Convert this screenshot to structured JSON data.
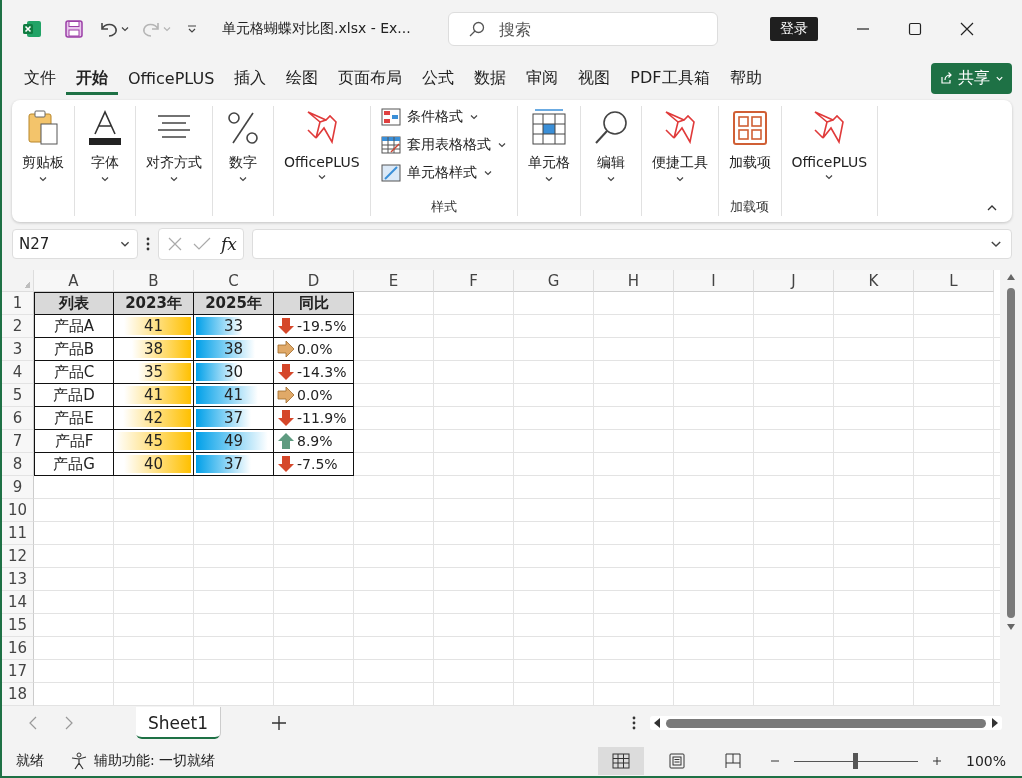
{
  "title_bar": {
    "file_title": "单元格蝴蝶对比图.xlsx  -  Ex...",
    "search": {
      "placeholder": "搜索"
    },
    "sign_in": "登录",
    "redo_disabled": true
  },
  "menu_tabs": [
    {
      "label": "文件",
      "selected": false
    },
    {
      "label": "开始",
      "selected": true
    },
    {
      "label": "OfficePLUS",
      "selected": false
    },
    {
      "label": "插入",
      "selected": false
    },
    {
      "label": "绘图",
      "selected": false
    },
    {
      "label": "页面布局",
      "selected": false
    },
    {
      "label": "公式",
      "selected": false
    },
    {
      "label": "数据",
      "selected": false
    },
    {
      "label": "审阅",
      "selected": false
    },
    {
      "label": "视图",
      "selected": false
    },
    {
      "label": "PDF工具箱",
      "selected": false
    },
    {
      "label": "帮助",
      "selected": false
    }
  ],
  "share_button": "共享",
  "ribbon": [
    {
      "buttons": [
        {
          "kind": "clipboard",
          "label": "剪贴板",
          "dropdown": true
        }
      ]
    },
    {
      "buttons": [
        {
          "kind": "font",
          "label": "字体",
          "dropdown": true
        }
      ]
    },
    {
      "buttons": [
        {
          "kind": "align",
          "label": "对齐方式",
          "dropdown": true
        }
      ]
    },
    {
      "buttons": [
        {
          "kind": "percent",
          "label": "数字",
          "dropdown": true
        }
      ]
    },
    {
      "buttons": [
        {
          "kind": "bird",
          "label": "OfficePLUS",
          "dropdown": true
        }
      ]
    },
    {
      "label": "样式",
      "buttons": [
        {
          "kind": "conditional",
          "label": "条件格式",
          "dropdown": true
        },
        {
          "kind": "table",
          "label": "套用表格格式",
          "dropdown": true
        },
        {
          "kind": "cellstyle",
          "label": "单元格样式",
          "dropdown": true
        }
      ]
    },
    {
      "buttons": [
        {
          "kind": "cells",
          "label": "单元格",
          "dropdown": true
        }
      ]
    },
    {
      "buttons": [
        {
          "kind": "search",
          "label": "编辑",
          "dropdown": true
        }
      ]
    },
    {
      "buttons": [
        {
          "kind": "bird",
          "label": "便捷工具",
          "dropdown": true
        }
      ]
    },
    {
      "label": "加载项",
      "buttons": [
        {
          "kind": "addins",
          "label": "加载项",
          "dropdown": false
        }
      ]
    },
    {
      "buttons": [
        {
          "kind": "bird",
          "label": "OfficePLUS",
          "dropdown": true
        }
      ]
    }
  ],
  "formula_bar": {
    "name_box": "N27",
    "fx": "fx"
  },
  "column_headers": [
    "A",
    "B",
    "C",
    "D",
    "E",
    "F",
    "G",
    "H",
    "I",
    "J",
    "K",
    "L"
  ],
  "row_headers": [
    "1",
    "2",
    "3",
    "4",
    "5",
    "6",
    "7",
    "8",
    "9",
    "10",
    "11",
    "12",
    "13",
    "14",
    "15",
    "16",
    "17",
    "18"
  ],
  "table": {
    "columns": [
      "列表",
      "2023年",
      "2025年",
      "同比"
    ],
    "rows": [
      {
        "name": "产品A",
        "y2023": {
          "value": "41",
          "level": 0.88
        },
        "y2025": {
          "value": "33",
          "level": 0.6
        },
        "change": {
          "text": "-19.5%",
          "kind": "down"
        }
      },
      {
        "name": "产品B",
        "y2023": {
          "value": "38",
          "level": 0.78
        },
        "y2025": {
          "value": "38",
          "level": 0.78
        },
        "change": {
          "text": "0.0%",
          "kind": "flat"
        }
      },
      {
        "name": "产品C",
        "y2023": {
          "value": "35",
          "level": 0.7
        },
        "y2025": {
          "value": "30",
          "level": 0.57
        },
        "change": {
          "text": "-14.3%",
          "kind": "down"
        }
      },
      {
        "name": "产品D",
        "y2023": {
          "value": "41",
          "level": 0.88
        },
        "y2025": {
          "value": "41",
          "level": 0.82
        },
        "change": {
          "text": "0.0%",
          "kind": "flat"
        }
      },
      {
        "name": "产品E",
        "y2023": {
          "value": "42",
          "level": 0.9
        },
        "y2025": {
          "value": "37",
          "level": 0.72
        },
        "change": {
          "text": "-11.9%",
          "kind": "down"
        }
      },
      {
        "name": "产品F",
        "y2023": {
          "value": "45",
          "level": 1.0
        },
        "y2025": {
          "value": "49",
          "level": 0.95
        },
        "change": {
          "text": "8.9%",
          "kind": "up"
        }
      },
      {
        "name": "产品G",
        "y2023": {
          "value": "40",
          "level": 0.88
        },
        "y2025": {
          "value": "37",
          "level": 0.72
        },
        "change": {
          "text": "-7.5%",
          "kind": "down"
        }
      }
    ]
  },
  "sheet_tabs": [
    {
      "label": "Sheet1",
      "selected": true
    }
  ],
  "status_bar": {
    "ready": "就绪",
    "accessibility": "辅助功能: 一切就绪",
    "views": [
      {
        "kind": "normal",
        "selected": true
      },
      {
        "kind": "page_layout",
        "selected": false
      },
      {
        "kind": "page_break",
        "selected": false
      }
    ],
    "zoom": {
      "level": 0.5,
      "reading": "100%"
    }
  }
}
